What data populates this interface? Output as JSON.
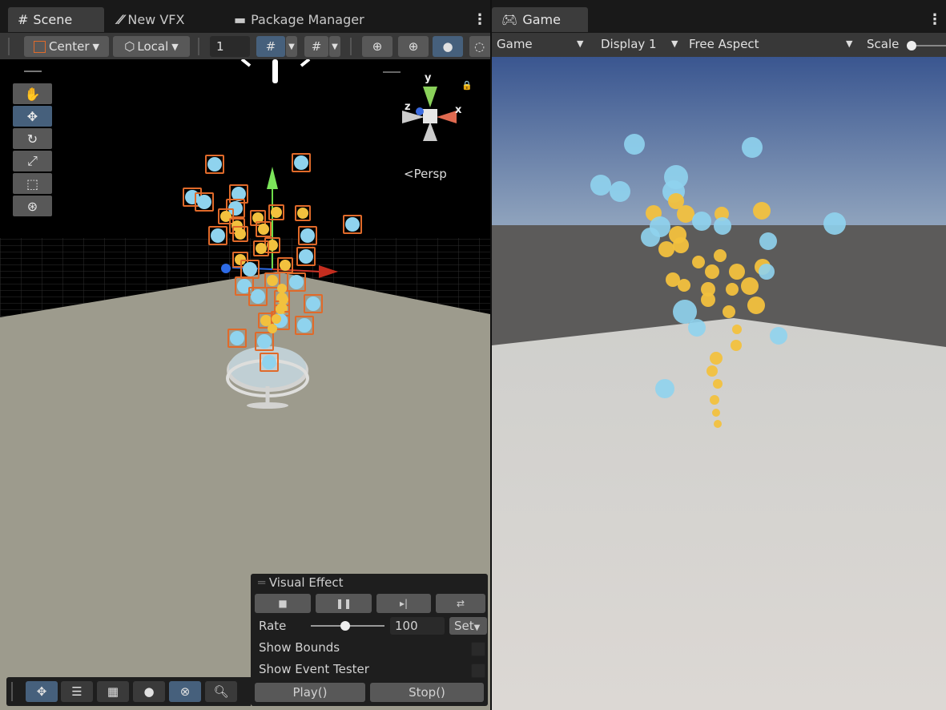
{
  "scene_tabs": [
    {
      "label": "Scene",
      "icon": "grid-hash-icon"
    },
    {
      "label": "New VFX",
      "icon": "vfx-graph-icon"
    },
    {
      "label": "Package Manager",
      "icon": "package-icon"
    }
  ],
  "game_tab": {
    "label": "Game",
    "icon": "gamepad-icon"
  },
  "scene_toolbar": {
    "pivot_label": "Center",
    "space_label": "Local",
    "grid_size_value": "1"
  },
  "gizmo": {
    "y": "y",
    "x": "x",
    "z": "z",
    "projection": "Persp"
  },
  "game_toolbar": {
    "view_mode": "Game",
    "display": "Display 1",
    "aspect": "Free Aspect",
    "scale_label": "Scale"
  },
  "vfx_panel": {
    "title": "Visual Effect",
    "rate_label": "Rate",
    "rate_value": "100",
    "rate_fraction": 0.47,
    "set_label": "Set",
    "show_bounds_label": "Show Bounds",
    "show_event_tester_label": "Show Event Tester",
    "play_label": "Play()",
    "stop_label": "Stop()"
  },
  "colors": {
    "accent": "#46607c",
    "particle_blue": "#8fd3ee",
    "particle_orange": "#f2c13e",
    "selection": "#e06a2a"
  }
}
